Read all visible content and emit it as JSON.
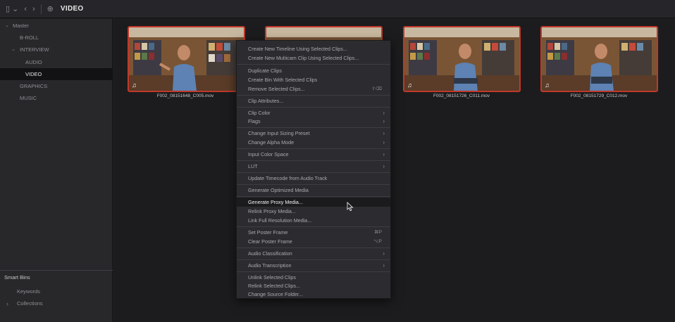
{
  "topbar": {
    "panel_icon": "▯ ⌄",
    "back_icon": "‹",
    "forward_icon": "›",
    "bin_icon": "⊕",
    "title": "VIDEO"
  },
  "sidebar": {
    "items": [
      {
        "label": "Master",
        "expanded": true
      },
      {
        "label": "B-ROLL"
      },
      {
        "label": "INTERVIEW",
        "expanded": true
      },
      {
        "label": "AUDIO"
      },
      {
        "label": "VIDEO",
        "selected": true
      },
      {
        "label": "GRAPHICS"
      },
      {
        "label": "MUSIC"
      }
    ],
    "smart_bins": {
      "title": "Smart Bins",
      "items": [
        {
          "label": "Keywords"
        },
        {
          "label": "Collections",
          "collapsed": true
        }
      ]
    }
  },
  "clips": [
    {
      "name": "F002_08151648_C005.mov",
      "icon": "♫"
    },
    {
      "name": "",
      "icon": "♫"
    },
    {
      "name": "F002_08151726_C011.mov",
      "icon": "♫"
    },
    {
      "name": "F002_08151729_C012.mov",
      "icon": "♫"
    }
  ],
  "context_menu": {
    "items": [
      {
        "label": "Create New Timeline Using Selected Clips..."
      },
      {
        "label": "Create New Multicam Clip Using Selected Clips..."
      },
      {
        "label": "Duplicate Clips"
      },
      {
        "label": "Create Bin With Selected Clips"
      },
      {
        "label": "Remove Selected Clips...",
        "shortcut": "⇧⌫"
      },
      {
        "label": "Clip Attributes..."
      },
      {
        "label": "Clip Color",
        "submenu": true
      },
      {
        "label": "Flags",
        "submenu": true
      },
      {
        "label": "Change Input Sizing Preset",
        "submenu": true
      },
      {
        "label": "Change Alpha Mode",
        "submenu": true
      },
      {
        "label": "Input Color Space",
        "submenu": true
      },
      {
        "label": "LUT",
        "submenu": true
      },
      {
        "label": "Update Timecode from Audio Track"
      },
      {
        "label": "Generate Optimized Media"
      },
      {
        "label": "Generate Proxy Media...",
        "highlighted": true
      },
      {
        "label": "Relink Proxy Media..."
      },
      {
        "label": "Link Full Resolution Media..."
      },
      {
        "label": "Set Poster Frame",
        "shortcut": "⌘P"
      },
      {
        "label": "Clear Poster Frame",
        "shortcut": "⌥P"
      },
      {
        "label": "Audio Classification",
        "submenu": true
      },
      {
        "label": "Audio Transcription",
        "submenu": true
      },
      {
        "label": "Unlink Selected Clips"
      },
      {
        "label": "Relink Selected Clips..."
      },
      {
        "label": "Change Source Folder..."
      }
    ],
    "submenu_arrow": "›"
  },
  "colors": {
    "selection_border": "#c0392b",
    "menu_bg": "#2c2c30"
  }
}
